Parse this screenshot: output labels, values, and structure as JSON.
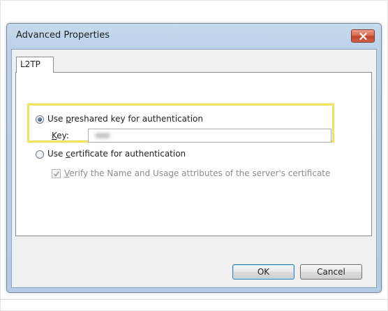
{
  "dialog": {
    "title": "Advanced Properties",
    "close_icon": "close-x-icon"
  },
  "tabs": [
    {
      "label": "L2TP",
      "selected": true
    }
  ],
  "options": {
    "preshared": {
      "label_prefix": "Use ",
      "label_accel": "p",
      "label_suffix": "reshared key for authentication",
      "checked": true
    },
    "key": {
      "label_accel": "K",
      "label_suffix": "ey:"
    },
    "certificate": {
      "label_prefix": "Use ",
      "label_accel": "c",
      "label_suffix": "ertificate for authentication",
      "checked": false
    },
    "verify": {
      "label_accel": "V",
      "label_suffix": "erify the Name and Usage attributes of the server's certificate",
      "checked": true,
      "disabled": true
    }
  },
  "buttons": {
    "ok": "OK",
    "cancel": "Cancel"
  },
  "colors": {
    "highlight": "#f2e25a",
    "close_button": "#c9503a"
  }
}
